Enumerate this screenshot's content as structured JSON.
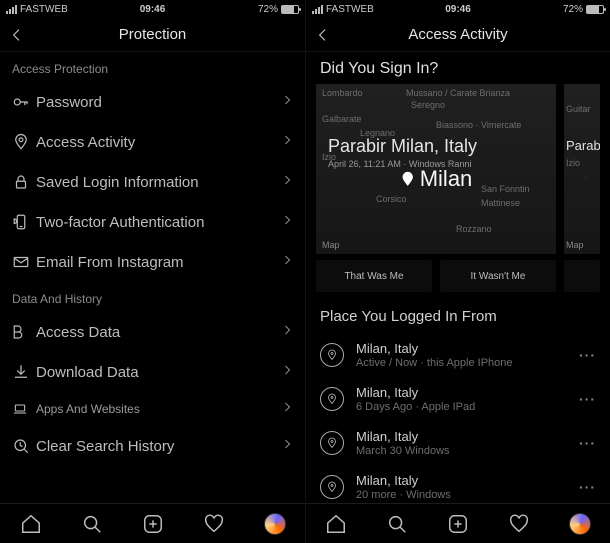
{
  "status": {
    "carrier": "FASTWEB",
    "time": "09:46",
    "battery_pct": "72%"
  },
  "left": {
    "title": "Protection",
    "sections": {
      "access_protection": {
        "label": "Access Protection",
        "items": {
          "password": "Password",
          "access_activity": "Access Activity",
          "saved_login": "Saved Login Information",
          "two_factor": "Two-factor Authentication",
          "email_from_ig": "Email From Instagram"
        }
      },
      "data_history": {
        "label": "Data And History",
        "items": {
          "access_data": "Access Data",
          "download_data": "Download Data",
          "apps_websites": "Apps And Websites",
          "clear_history": "Clear Search History"
        }
      }
    }
  },
  "right": {
    "title": "Access Activity",
    "prompt": "Did You Sign In?",
    "card": {
      "title_city": "Milan",
      "title_sub_line": "Parabir Milan, Italy",
      "meta": "April 26, 11:21 AM · Windows Ranni",
      "map_credit": "Map",
      "apple_credit": "Map",
      "map_labels": {
        "a": "Lombardo",
        "b": "Mussano / Carate Brianza",
        "c": "Seregno",
        "d": "Galbarate",
        "e": "Legnano",
        "f": "Biassono · Vimercate",
        "g": "Izio",
        "h": "Corsico",
        "i": "San Fonntin",
        "j": "Mattinese",
        "k": "Rozzano"
      },
      "peek_label": "Parabi",
      "peek_sub": "Guitar",
      "peek_meta": "Izio",
      "btn_yes": "That Was Me",
      "btn_no": "It Wasn't Me"
    },
    "logged_from_label": "Place You Logged In From",
    "logins": [
      {
        "place": "Milan, Italy",
        "meta": "Active / Now · this Apple IPhone"
      },
      {
        "place": "Milan, Italy",
        "meta": "6 Days Ago · Apple IPad"
      },
      {
        "place": "Milan, Italy",
        "meta": "March 30 Windows"
      },
      {
        "place": "Milan, Italy",
        "meta": "20 more · Windows"
      }
    ]
  }
}
